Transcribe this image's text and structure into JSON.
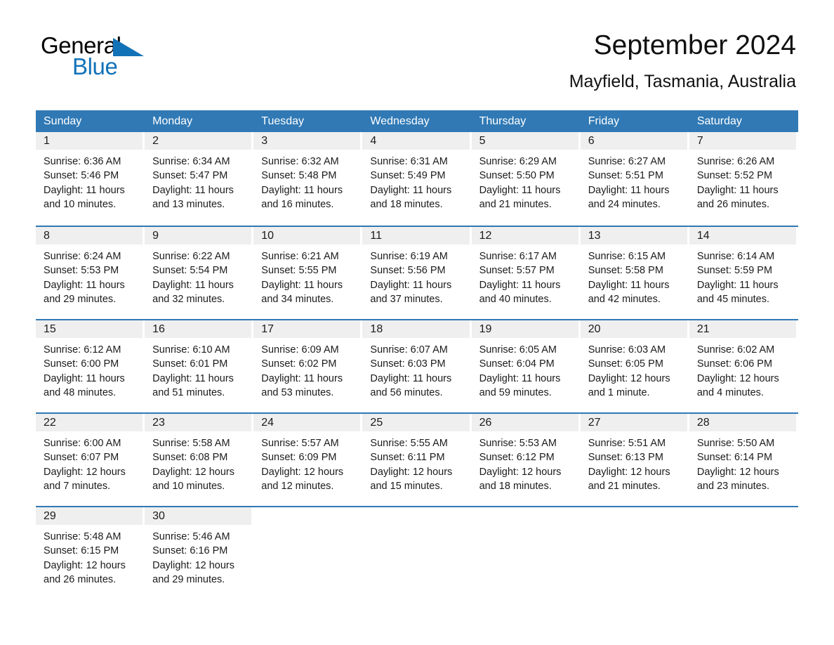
{
  "brand": {
    "name_top": "General",
    "name_bottom": "Blue",
    "accent_color": "#1272b8",
    "logo_triangle": "triangle-icon"
  },
  "header": {
    "title": "September 2024",
    "subtitle": "Mayfield, Tasmania, Australia"
  },
  "theme": {
    "header_row_bg": "#3079b5",
    "daynum_band_bg": "#efefef",
    "row_rule_color": "#3079b5",
    "text_color": "#1b1b1b",
    "page_bg": "#ffffff"
  },
  "calendar": {
    "weekdays": [
      "Sunday",
      "Monday",
      "Tuesday",
      "Wednesday",
      "Thursday",
      "Friday",
      "Saturday"
    ],
    "weeks": [
      [
        {
          "day": "1",
          "sunrise": "Sunrise: 6:36 AM",
          "sunset": "Sunset: 5:46 PM",
          "daylight": "Daylight: 11 hours and 10 minutes."
        },
        {
          "day": "2",
          "sunrise": "Sunrise: 6:34 AM",
          "sunset": "Sunset: 5:47 PM",
          "daylight": "Daylight: 11 hours and 13 minutes."
        },
        {
          "day": "3",
          "sunrise": "Sunrise: 6:32 AM",
          "sunset": "Sunset: 5:48 PM",
          "daylight": "Daylight: 11 hours and 16 minutes."
        },
        {
          "day": "4",
          "sunrise": "Sunrise: 6:31 AM",
          "sunset": "Sunset: 5:49 PM",
          "daylight": "Daylight: 11 hours and 18 minutes."
        },
        {
          "day": "5",
          "sunrise": "Sunrise: 6:29 AM",
          "sunset": "Sunset: 5:50 PM",
          "daylight": "Daylight: 11 hours and 21 minutes."
        },
        {
          "day": "6",
          "sunrise": "Sunrise: 6:27 AM",
          "sunset": "Sunset: 5:51 PM",
          "daylight": "Daylight: 11 hours and 24 minutes."
        },
        {
          "day": "7",
          "sunrise": "Sunrise: 6:26 AM",
          "sunset": "Sunset: 5:52 PM",
          "daylight": "Daylight: 11 hours and 26 minutes."
        }
      ],
      [
        {
          "day": "8",
          "sunrise": "Sunrise: 6:24 AM",
          "sunset": "Sunset: 5:53 PM",
          "daylight": "Daylight: 11 hours and 29 minutes."
        },
        {
          "day": "9",
          "sunrise": "Sunrise: 6:22 AM",
          "sunset": "Sunset: 5:54 PM",
          "daylight": "Daylight: 11 hours and 32 minutes."
        },
        {
          "day": "10",
          "sunrise": "Sunrise: 6:21 AM",
          "sunset": "Sunset: 5:55 PM",
          "daylight": "Daylight: 11 hours and 34 minutes."
        },
        {
          "day": "11",
          "sunrise": "Sunrise: 6:19 AM",
          "sunset": "Sunset: 5:56 PM",
          "daylight": "Daylight: 11 hours and 37 minutes."
        },
        {
          "day": "12",
          "sunrise": "Sunrise: 6:17 AM",
          "sunset": "Sunset: 5:57 PM",
          "daylight": "Daylight: 11 hours and 40 minutes."
        },
        {
          "day": "13",
          "sunrise": "Sunrise: 6:15 AM",
          "sunset": "Sunset: 5:58 PM",
          "daylight": "Daylight: 11 hours and 42 minutes."
        },
        {
          "day": "14",
          "sunrise": "Sunrise: 6:14 AM",
          "sunset": "Sunset: 5:59 PM",
          "daylight": "Daylight: 11 hours and 45 minutes."
        }
      ],
      [
        {
          "day": "15",
          "sunrise": "Sunrise: 6:12 AM",
          "sunset": "Sunset: 6:00 PM",
          "daylight": "Daylight: 11 hours and 48 minutes."
        },
        {
          "day": "16",
          "sunrise": "Sunrise: 6:10 AM",
          "sunset": "Sunset: 6:01 PM",
          "daylight": "Daylight: 11 hours and 51 minutes."
        },
        {
          "day": "17",
          "sunrise": "Sunrise: 6:09 AM",
          "sunset": "Sunset: 6:02 PM",
          "daylight": "Daylight: 11 hours and 53 minutes."
        },
        {
          "day": "18",
          "sunrise": "Sunrise: 6:07 AM",
          "sunset": "Sunset: 6:03 PM",
          "daylight": "Daylight: 11 hours and 56 minutes."
        },
        {
          "day": "19",
          "sunrise": "Sunrise: 6:05 AM",
          "sunset": "Sunset: 6:04 PM",
          "daylight": "Daylight: 11 hours and 59 minutes."
        },
        {
          "day": "20",
          "sunrise": "Sunrise: 6:03 AM",
          "sunset": "Sunset: 6:05 PM",
          "daylight": "Daylight: 12 hours and 1 minute."
        },
        {
          "day": "21",
          "sunrise": "Sunrise: 6:02 AM",
          "sunset": "Sunset: 6:06 PM",
          "daylight": "Daylight: 12 hours and 4 minutes."
        }
      ],
      [
        {
          "day": "22",
          "sunrise": "Sunrise: 6:00 AM",
          "sunset": "Sunset: 6:07 PM",
          "daylight": "Daylight: 12 hours and 7 minutes."
        },
        {
          "day": "23",
          "sunrise": "Sunrise: 5:58 AM",
          "sunset": "Sunset: 6:08 PM",
          "daylight": "Daylight: 12 hours and 10 minutes."
        },
        {
          "day": "24",
          "sunrise": "Sunrise: 5:57 AM",
          "sunset": "Sunset: 6:09 PM",
          "daylight": "Daylight: 12 hours and 12 minutes."
        },
        {
          "day": "25",
          "sunrise": "Sunrise: 5:55 AM",
          "sunset": "Sunset: 6:11 PM",
          "daylight": "Daylight: 12 hours and 15 minutes."
        },
        {
          "day": "26",
          "sunrise": "Sunrise: 5:53 AM",
          "sunset": "Sunset: 6:12 PM",
          "daylight": "Daylight: 12 hours and 18 minutes."
        },
        {
          "day": "27",
          "sunrise": "Sunrise: 5:51 AM",
          "sunset": "Sunset: 6:13 PM",
          "daylight": "Daylight: 12 hours and 21 minutes."
        },
        {
          "day": "28",
          "sunrise": "Sunrise: 5:50 AM",
          "sunset": "Sunset: 6:14 PM",
          "daylight": "Daylight: 12 hours and 23 minutes."
        }
      ],
      [
        {
          "day": "29",
          "sunrise": "Sunrise: 5:48 AM",
          "sunset": "Sunset: 6:15 PM",
          "daylight": "Daylight: 12 hours and 26 minutes."
        },
        {
          "day": "30",
          "sunrise": "Sunrise: 5:46 AM",
          "sunset": "Sunset: 6:16 PM",
          "daylight": "Daylight: 12 hours and 29 minutes."
        },
        {
          "day": "",
          "sunrise": "",
          "sunset": "",
          "daylight": ""
        },
        {
          "day": "",
          "sunrise": "",
          "sunset": "",
          "daylight": ""
        },
        {
          "day": "",
          "sunrise": "",
          "sunset": "",
          "daylight": ""
        },
        {
          "day": "",
          "sunrise": "",
          "sunset": "",
          "daylight": ""
        },
        {
          "day": "",
          "sunrise": "",
          "sunset": "",
          "daylight": ""
        }
      ]
    ]
  }
}
